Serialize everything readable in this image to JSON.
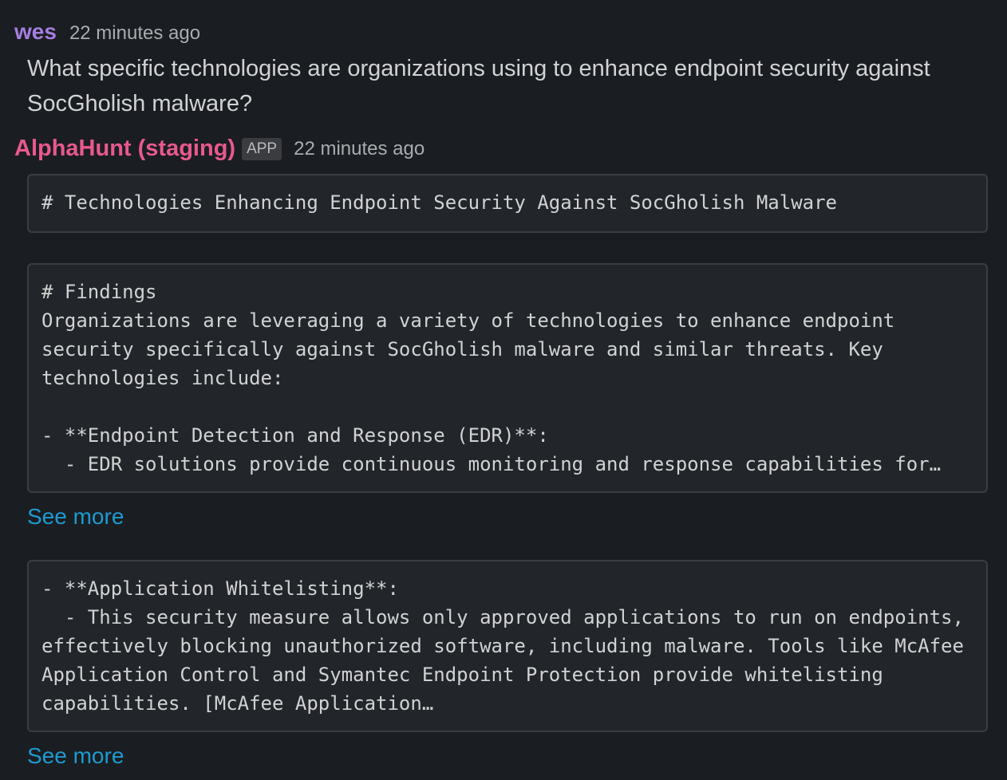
{
  "messages": [
    {
      "author": "wes",
      "timestamp": "22 minutes ago",
      "text": "What specific technologies are organizations using to enhance endpoint security against SocGholish malware?"
    },
    {
      "author": "AlphaHunt (staging)",
      "badge": "APP",
      "timestamp": "22 minutes ago",
      "blocks": [
        {
          "code": "# Technologies Enhancing Endpoint Security Against SocGholish Malware"
        },
        {
          "code": "# Findings\nOrganizations are leveraging a variety of technologies to enhance endpoint\nsecurity specifically against SocGholish malware and similar threats. Key\ntechnologies include:\n\n- **Endpoint Detection and Response (EDR)**:\n  - EDR solutions provide continuous monitoring and response capabilities for…",
          "see_more": "See more"
        },
        {
          "code": "- **Application Whitelisting**:\n  - This security measure allows only approved applications to run on endpoints,\neffectively blocking unauthorized software, including malware. Tools like McAfee\nApplication Control and Symantec Endpoint Protection provide whitelisting\ncapabilities. [McAfee Application…",
          "see_more": "See more"
        }
      ]
    }
  ],
  "colors": {
    "background": "#1a1d21",
    "user_author": "#a57ee0",
    "bot_author": "#e8598e",
    "link": "#1d9bd1",
    "code_bg": "#222529"
  }
}
